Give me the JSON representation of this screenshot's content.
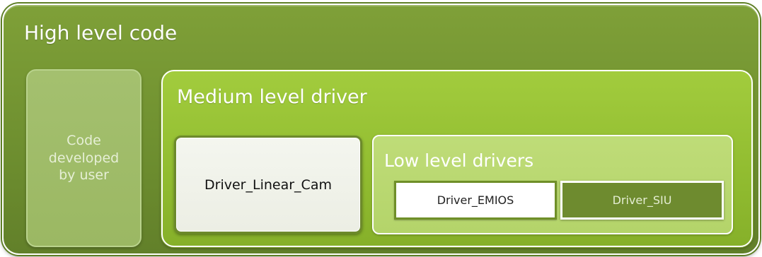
{
  "diagram": {
    "high_level": {
      "label": "High level code",
      "color": "#6f9030"
    },
    "user_code": {
      "label": "Code\ndeveloped\nby user",
      "color": "#9bb863"
    },
    "medium_level": {
      "label": "Medium level driver",
      "color": "#91bc30"
    },
    "linear_cam": {
      "label": "Driver_Linear_Cam",
      "color": "#eceee4"
    },
    "low_level": {
      "label": "Low level drivers",
      "color": "#b4d46a",
      "drivers": [
        {
          "label": "Driver_EMIOS",
          "color": "#ffffff"
        },
        {
          "label": "Driver_SIU",
          "color": "#6e8b2f"
        }
      ]
    }
  }
}
